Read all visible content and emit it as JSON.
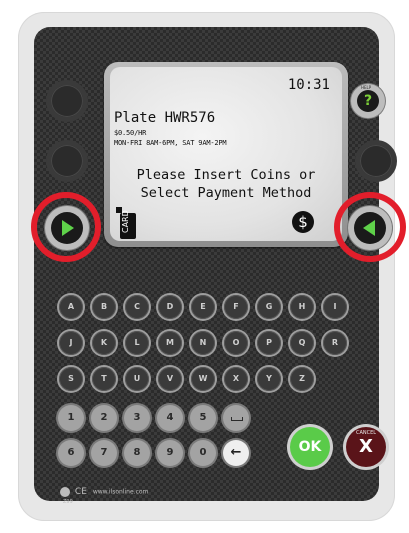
{
  "screen": {
    "clock": "10:31",
    "plate": "Plate HWR576",
    "rate": "$0.50/HR",
    "hours": "MON-FRI 8AM-6PM, SAT 9AM-2PM",
    "prompt_line1": "Please Insert Coins or",
    "prompt_line2": "Select Payment Method",
    "card_label": "CARD",
    "dollar_symbol": "$"
  },
  "help_button": {
    "symbol": "?",
    "caption": "HELP"
  },
  "keys": {
    "row1": [
      "A",
      "B",
      "C",
      "D",
      "E",
      "F",
      "G",
      "H",
      "I"
    ],
    "row2": [
      "J",
      "K",
      "L",
      "M",
      "N",
      "O",
      "P",
      "Q",
      "R"
    ],
    "row3": [
      "S",
      "T",
      "U",
      "V",
      "W",
      "X",
      "Y",
      "Z"
    ],
    "row4": [
      "1",
      "2",
      "3",
      "4",
      "5"
    ],
    "row5": [
      "6",
      "7",
      "8",
      "9",
      "0"
    ],
    "backspace_symbol": "←"
  },
  "ok_button": {
    "label": "OK",
    "color": "#5acb49"
  },
  "cancel_button": {
    "label": "X",
    "caption": "CANCEL",
    "color": "#5a1419"
  },
  "highlight_color": "#e21e2b",
  "arrow_color": "#5fd24a",
  "footer": {
    "ce": "CE",
    "site": "www.ilsonline.com",
    "model": "Z99"
  }
}
